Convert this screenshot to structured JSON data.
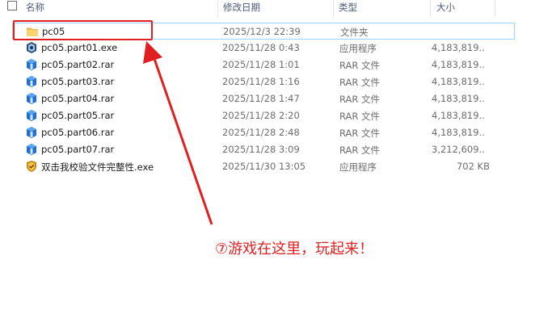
{
  "header": {
    "name": "名称",
    "date": "修改日期",
    "type": "类型",
    "size": "大小"
  },
  "files": [
    {
      "name": "pc05",
      "date": "2025/12/3 22:39",
      "type": "文件夹",
      "size": "",
      "icon": "folder-icon"
    },
    {
      "name": "pc05.part01.exe",
      "date": "2025/11/28 0:43",
      "type": "应用程序",
      "size": "4,183,819...",
      "icon": "exe-icon"
    },
    {
      "name": "pc05.part02.rar",
      "date": "2025/11/28 1:01",
      "type": "RAR 文件",
      "size": "4,183,819...",
      "icon": "rar-icon"
    },
    {
      "name": "pc05.part03.rar",
      "date": "2025/11/28 1:16",
      "type": "RAR 文件",
      "size": "4,183,819...",
      "icon": "rar-icon"
    },
    {
      "name": "pc05.part04.rar",
      "date": "2025/11/28 1:47",
      "type": "RAR 文件",
      "size": "4,183,819...",
      "icon": "rar-icon"
    },
    {
      "name": "pc05.part05.rar",
      "date": "2025/11/28 2:20",
      "type": "RAR 文件",
      "size": "4,183,819...",
      "icon": "rar-icon"
    },
    {
      "name": "pc05.part06.rar",
      "date": "2025/11/28 2:48",
      "type": "RAR 文件",
      "size": "4,183,819...",
      "icon": "rar-icon"
    },
    {
      "name": "pc05.part07.rar",
      "date": "2025/11/28 3:09",
      "type": "RAR 文件",
      "size": "3,212,609...",
      "icon": "rar-icon"
    },
    {
      "name": "双击我校验文件完整性.exe",
      "date": "2025/11/30 13:05",
      "type": "应用程序",
      "size": "702 KB",
      "icon": "verify-exe-icon"
    }
  ],
  "annotation": {
    "text": "⑦游戏在这里，玩起来！",
    "color": "#e02020"
  },
  "colors": {
    "accent": "#e02020",
    "selection_border": "#99d1ff",
    "header_text": "#4b5b76"
  }
}
